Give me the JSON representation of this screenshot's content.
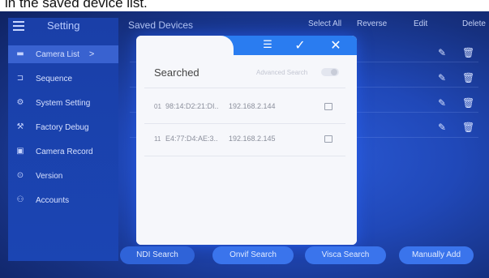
{
  "caption": "in the saved device list.",
  "sidebar": {
    "title": "Setting",
    "items": [
      {
        "label": "Camera List",
        "icon": "camera-icon",
        "active": true,
        "chevron": ">"
      },
      {
        "label": "Sequence",
        "icon": "sequence-icon",
        "active": false
      },
      {
        "label": "System Setting",
        "icon": "gear-icon",
        "active": false
      },
      {
        "label": "Factory Debug",
        "icon": "debug-icon",
        "active": false
      },
      {
        "label": "Camera Record",
        "icon": "record-icon",
        "active": false
      },
      {
        "label": "Version",
        "icon": "version-icon",
        "active": false
      },
      {
        "label": "Accounts",
        "icon": "accounts-icon",
        "active": false
      }
    ]
  },
  "main": {
    "title": "Saved Devices",
    "actions": {
      "select_all": "Select All",
      "reverse": "Reverse",
      "edit": "Edit",
      "delete": "Delete"
    }
  },
  "dialog": {
    "title": "Searched",
    "advanced_search": "Advanced Search",
    "toggle_glyph": "»",
    "devices": [
      {
        "index": "01",
        "mac": "98:14:D2:21:DI..",
        "ip": "192.168.2.144"
      },
      {
        "index": "11",
        "mac": "E4:77:D4:AE:3..",
        "ip": "192.168.2.145"
      }
    ]
  },
  "bottom_buttons": {
    "ndi_search": "NDI Search",
    "onvif_search": "Onvif Search",
    "visca_search": "Visca Search",
    "manually_add": "Manually Add"
  },
  "colors": {
    "screen_blue": "#2048b8",
    "dialog_header": "#2a7cf0",
    "button_blue": "#3a74ec"
  }
}
